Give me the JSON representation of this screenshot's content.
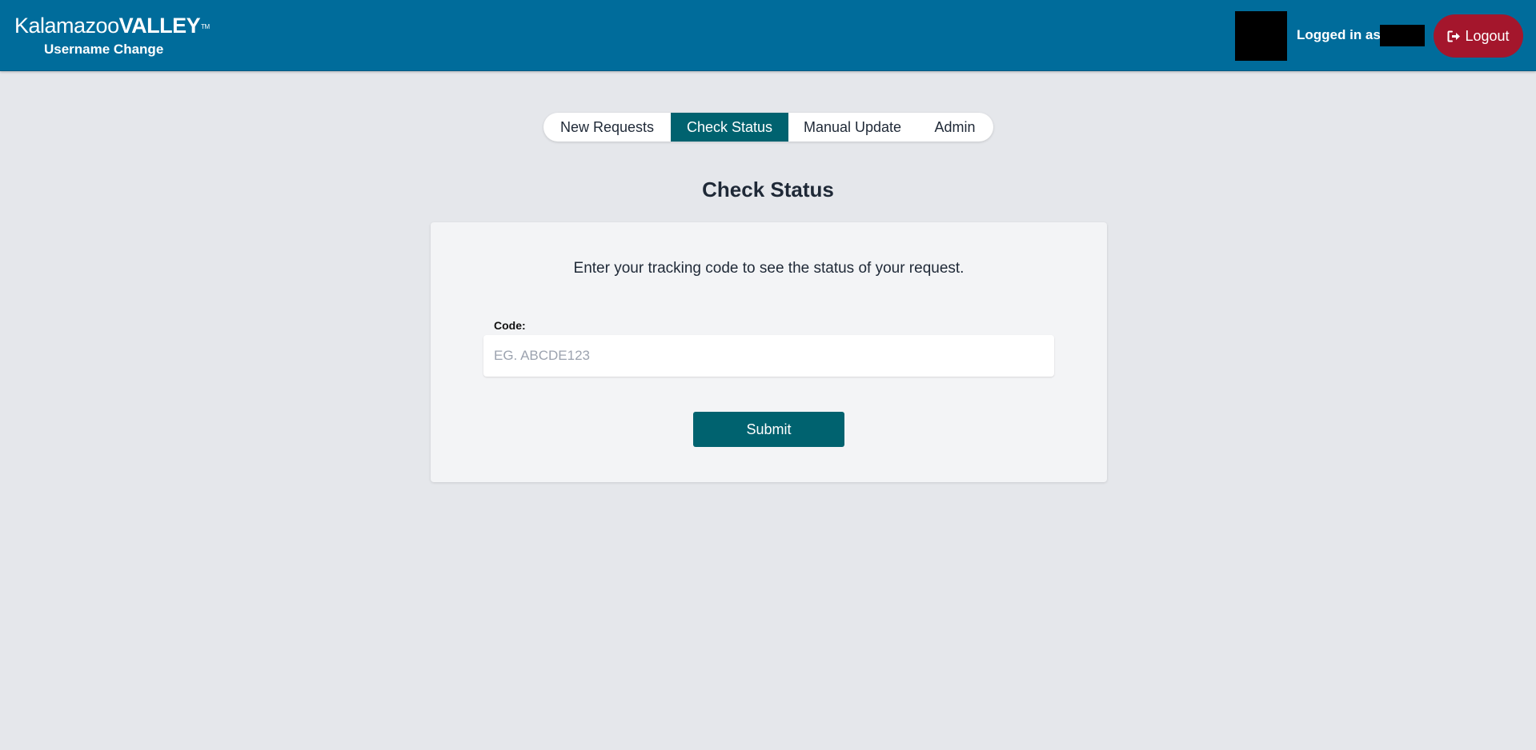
{
  "header": {
    "brand_light": "Kalamazoo",
    "brand_bold": "VALLEY",
    "brand_tm": "TM",
    "app_name": "Username Change",
    "logged_in_text": "Logged in as,",
    "logout_label": "Logout",
    "color": "#006c9b",
    "logout_color": "#a4162c"
  },
  "tabs": [
    {
      "label": "New Requests",
      "active": false
    },
    {
      "label": "Check Status",
      "active": true
    },
    {
      "label": "Manual Update",
      "active": false
    },
    {
      "label": "Admin",
      "active": false
    }
  ],
  "main": {
    "title": "Check Status",
    "intro": "Enter your tracking code to see the status of your request.",
    "code_label": "Code:",
    "code_value": "",
    "code_placeholder": "EG. ABCDE123",
    "submit_label": "Submit"
  },
  "colors": {
    "accent": "#00626f",
    "background": "#e5e7eb",
    "card": "#f3f4f6"
  },
  "icons": {
    "logout": "sign-out-icon",
    "avatar": "avatar"
  }
}
